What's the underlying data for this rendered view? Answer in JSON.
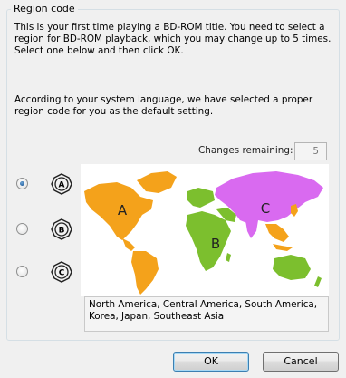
{
  "group": {
    "title": "Region code"
  },
  "intro": "This is your first time playing a BD-ROM title. You need to select a region for BD-ROM playback, which you may change up to 5 times. Select one below and then click OK.",
  "language_note": "According to your system language, we have selected a proper region code for you as the default setting.",
  "changes": {
    "label": "Changes remaining:",
    "value": "5"
  },
  "regions": [
    {
      "letter": "A",
      "selected": true
    },
    {
      "letter": "B",
      "selected": false
    },
    {
      "letter": "C",
      "selected": false
    }
  ],
  "map": {
    "labels": {
      "a": "A",
      "b": "B",
      "c": "C"
    },
    "colors": {
      "a": "#f4a21b",
      "b": "#7cbf2e",
      "c": "#d96af0"
    }
  },
  "description": "North America, Central America, South America, Korea, Japan, Southeast Asia",
  "buttons": {
    "ok": "OK",
    "cancel": "Cancel"
  }
}
